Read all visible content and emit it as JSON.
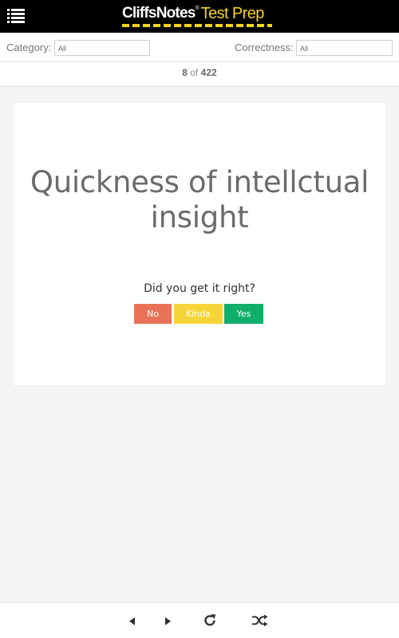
{
  "header": {
    "brand": "CliffsNotes",
    "registered": "®",
    "product": "Test Prep",
    "icons": {
      "menu": "menu-list-icon"
    },
    "colors": {
      "background": "#000000",
      "accent": "#f4d41c"
    }
  },
  "filters": {
    "category_label": "Category:",
    "category_value": "All",
    "correctness_label": "Correctness:",
    "correctness_value": "All"
  },
  "counter": {
    "current": "8",
    "separator": "of",
    "total": "422"
  },
  "card": {
    "term": "Quickness of intellctual insight",
    "question": "Did you get it right?",
    "buttons": {
      "no": "No",
      "kinda": "Kinda",
      "yes": "Yes"
    },
    "colors": {
      "no": "#e87158",
      "kinda": "#f5d53a",
      "yes": "#0fae6a"
    }
  },
  "toolbar": {
    "icons": [
      "previous-icon",
      "next-icon",
      "reload-icon",
      "shuffle-icon"
    ]
  }
}
